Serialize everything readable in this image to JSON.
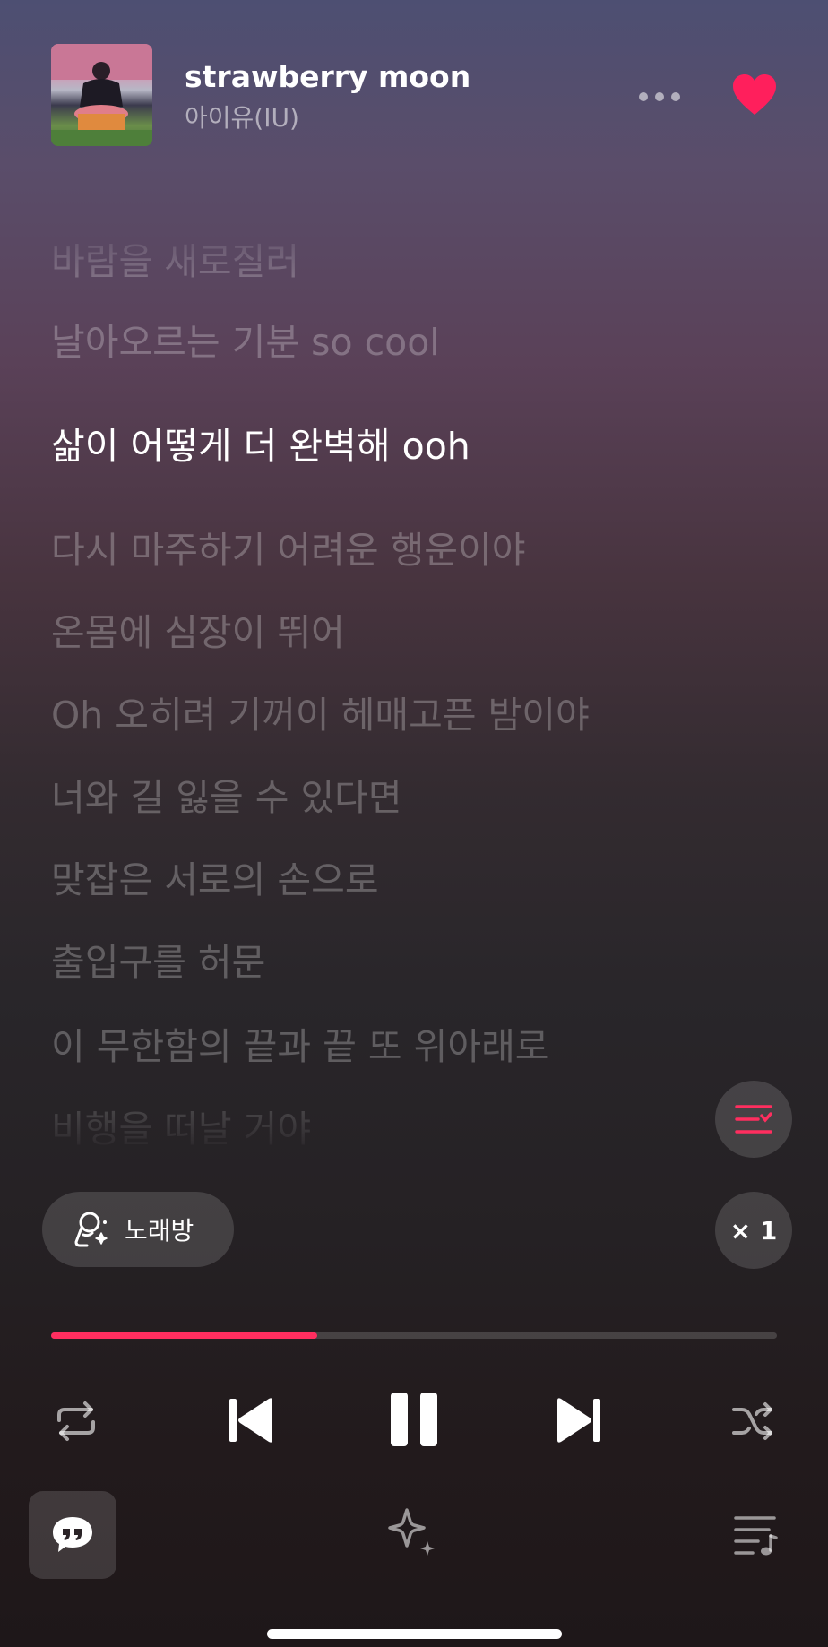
{
  "player": {
    "title": "strawberry moon",
    "artist": "아이유(IU)",
    "liked": true,
    "accent_color": "#ff2e5f",
    "progress": 0.367
  },
  "lyrics": [
    "바람을 새로질러",
    "날아오르는 기분 so cool",
    "삶이 어떻게 더 완벽해 ooh",
    "다시 마주하기 어려운 행운이야",
    "온몸에 심장이 뛰어",
    "Oh 오히려 기꺼이 헤매고픈 밤이야",
    "너와 길 잃을 수 있다면",
    "맞잡은 서로의 손으로",
    "출입구를 허문",
    "이 무한함의 끝과 끝 또 위아래로",
    "비행을 떠날 거야"
  ],
  "active_lyric_index": 2,
  "controls": {
    "karaoke_label": "노래방",
    "speed_label": "× 1"
  },
  "icons": [
    "more-icon",
    "heart-icon",
    "lyric-sync-icon",
    "karaoke-mic-icon",
    "repeat-icon",
    "previous-icon",
    "pause-icon",
    "next-icon",
    "shuffle-icon",
    "lyrics-quote-icon",
    "sparkle-icon",
    "queue-icon"
  ]
}
